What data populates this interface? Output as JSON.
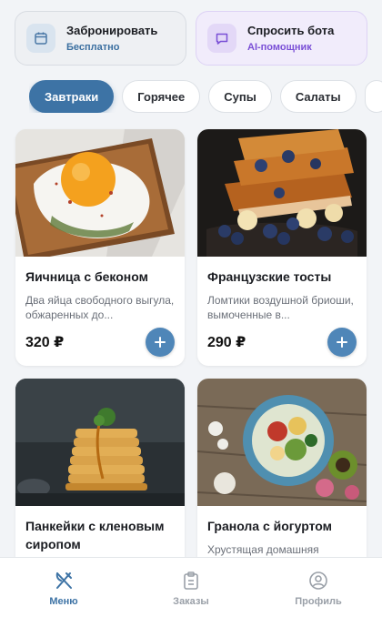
{
  "quick_actions": {
    "book": {
      "title": "Забронировать",
      "subtitle": "Бесплатно",
      "icon": "calendar-icon"
    },
    "bot": {
      "title": "Спросить бота",
      "subtitle": "AI-помощник",
      "icon": "chat-icon"
    }
  },
  "categories": [
    {
      "label": "Завтраки",
      "active": true
    },
    {
      "label": "Горячее",
      "active": false
    },
    {
      "label": "Супы",
      "active": false
    },
    {
      "label": "Салаты",
      "active": false
    }
  ],
  "dishes": [
    {
      "title": "Яичница с беконом",
      "description": "Два яйца свободного выгула, обжаренных до...",
      "price": "320 ₽"
    },
    {
      "title": "Французские тосты",
      "description": "Ломтики воздушной бриоши, вымоченные в...",
      "price": "290 ₽"
    },
    {
      "title": "Панкейки с кленовым сиропом",
      "description": "",
      "price": ""
    },
    {
      "title": "Гранола с йогуртом",
      "description": "Хрустящая домашняя гранола с тыквенными",
      "price": ""
    }
  ],
  "tabbar": {
    "menu": "Меню",
    "orders": "Заказы",
    "profile": "Профиль"
  },
  "colors": {
    "accent": "#3d73a5",
    "add_button": "#4f86b8",
    "bot_accent": "#7a4fd6"
  }
}
